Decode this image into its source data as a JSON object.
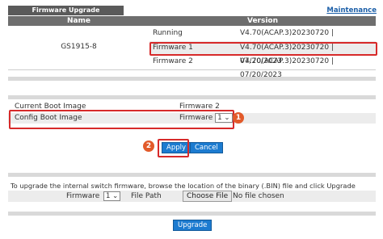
{
  "header": {
    "tab_title": "Firmware Upgrade",
    "maintenance_link": "Maintenance"
  },
  "version_table": {
    "col_name": "Name",
    "col_version": "Version",
    "device_name": "GS1915-8",
    "rows": [
      {
        "label": "Running",
        "version": "V4.70(ACAP.3)20230720 | 07/20/2023"
      },
      {
        "label": "Firmware 1",
        "version": "V4.70(ACAP.3)20230720 | 07/20/2023"
      },
      {
        "label": "Firmware 2",
        "version": "V4.70(ACAP.3)20230720 | 07/20/2023"
      }
    ]
  },
  "boot": {
    "current_label": "Current Boot Image",
    "current_value": "Firmware 2",
    "config_label": "Config Boot Image",
    "config_prefix": "Firmware",
    "config_selected": "1"
  },
  "annotations": {
    "badge1": "1",
    "badge2": "2",
    "highlight_color": "#d72a2a",
    "badge_color": "#e25a2a"
  },
  "actions": {
    "apply_label": "Apply",
    "cancel_label": "Cancel"
  },
  "upgrade": {
    "instruction": "To upgrade the internal switch firmware, browse the location of the binary (.BIN) file and click Upgrade button.",
    "firmware_label": "Firmware",
    "firmware_selected": "1",
    "file_path_label": "File Path",
    "choose_file_label": "Choose File",
    "no_file_text": "No file chosen",
    "upgrade_label": "Upgrade"
  },
  "colors": {
    "accent_button": "#1c7bd0",
    "header_bar": "#6e6e6e",
    "link": "#1c5fa8"
  }
}
